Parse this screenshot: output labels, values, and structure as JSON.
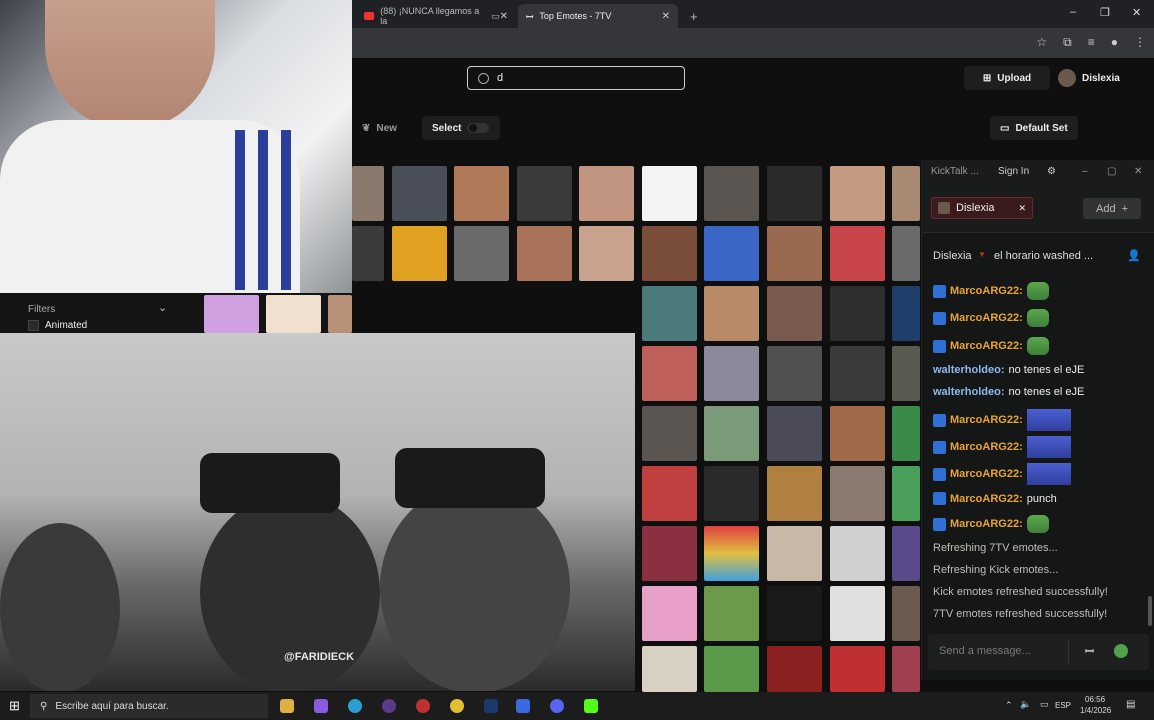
{
  "browser": {
    "tabs": [
      {
        "label": "(88) ¡NUNCA llegamos a la",
        "icon": "youtube-icon"
      },
      {
        "label": "Top Emotes - 7TV",
        "icon": "7tv-icon",
        "active": true
      }
    ],
    "new_tab": "+",
    "window_controls": [
      "–",
      "❐",
      "✕"
    ]
  },
  "seventv": {
    "search_value": "d",
    "upload_label": "Upload",
    "username": "Dislexia",
    "new_label": "New",
    "select_label": "Select",
    "default_set_label": "Default Set"
  },
  "filters": {
    "label": "Filters",
    "animated_label": "Animated"
  },
  "video": {
    "watermark": "@FARIDIECK"
  },
  "kicktalk": {
    "title": "KickTalk ...",
    "sign_in": "Sign In",
    "channel_tab": "Dislexia",
    "add_label": "Add",
    "header_user": "Dislexia",
    "header_message": "el horario washed ...",
    "messages": [
      {
        "user": "MarcoARG22:",
        "text": "",
        "emote": "pepe",
        "user_color": "#e8a33a",
        "badge": true
      },
      {
        "user": "MarcoARG22:",
        "text": "",
        "emote": "pepe",
        "user_color": "#e8a33a",
        "badge": true
      },
      {
        "user": "MarcoARG22:",
        "text": "",
        "emote": "pepe",
        "user_color": "#e8a33a",
        "badge": true
      },
      {
        "user": "walterholdeo:",
        "text": "no tenes el eJE",
        "emote": "",
        "user_color": "#8fb8f0",
        "badge": false
      },
      {
        "user": "walterholdeo:",
        "text": "no tenes el eJE",
        "emote": "",
        "user_color": "#8fb8f0",
        "badge": false
      },
      {
        "user": "MarcoARG22:",
        "text": "",
        "emote": "pepe-blue",
        "user_color": "#e8a33a",
        "badge": true
      },
      {
        "user": "MarcoARG22:",
        "text": "",
        "emote": "pepe-blue",
        "user_color": "#e8a33a",
        "badge": true
      },
      {
        "user": "MarcoARG22:",
        "text": "",
        "emote": "pepe-blue",
        "user_color": "#e8a33a",
        "badge": true
      },
      {
        "user": "MarcoARG22:",
        "text": "punch",
        "emote": "",
        "user_color": "#e8a33a",
        "badge": true
      },
      {
        "user": "MarcoARG22:",
        "text": "",
        "emote": "pepe",
        "user_color": "#e8a33a",
        "badge": true
      }
    ],
    "system_messages": [
      "Refreshing 7TV emotes...",
      "Refreshing Kick emotes...",
      "Kick emotes refreshed successfully!",
      "7TV emotes refreshed successfully!"
    ],
    "input_placeholder": "Send a message..."
  },
  "taskbar": {
    "search_placeholder": "Escribe aquí para buscar.",
    "language": "ESP",
    "time": "06:56",
    "date": "1/4/2026"
  },
  "colors": {
    "accent_green": "#53fc18",
    "kick_red": "#6a2a2e",
    "user_orange": "#e8a33a",
    "user_blue": "#8fb8f0"
  }
}
